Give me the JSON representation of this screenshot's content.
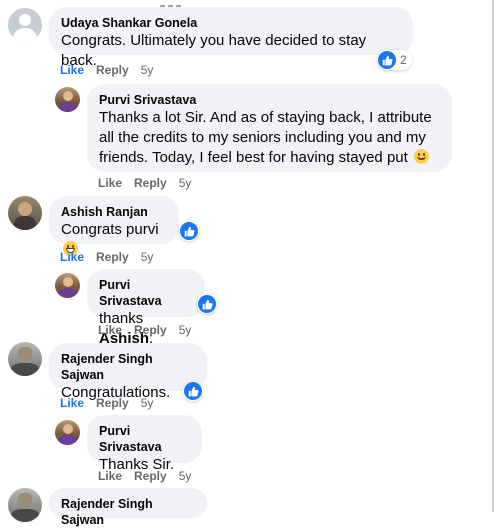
{
  "comments": [
    {
      "author": "Udaya Shankar Gonela",
      "text": "Congrats. Ultimately you have decided to stay back.",
      "reaction_count": "2",
      "like": "Like",
      "reply": "Reply",
      "age": "5y"
    },
    {
      "author": "Purvi Srivastava",
      "lines": [
        "Thanks a lot Sir. And as of staying back, I attribute",
        "all the credits to my seniors including you and my",
        "friends. Today, I feel best for having stayed put"
      ],
      "like": "Like",
      "reply": "Reply",
      "age": "5y"
    },
    {
      "author": "Ashish Ranjan",
      "text": "Congrats purvi",
      "like": "Like",
      "reply": "Reply",
      "age": "5y"
    },
    {
      "author": "Purvi Srivastava",
      "text_prefix": "thanks",
      "mention": "Ashish",
      "text_suffix": ".",
      "like": "Like",
      "reply": "Reply",
      "age": "5y"
    },
    {
      "author": "Rajender Singh Sajwan",
      "text": "Congratulations.",
      "like": "Like",
      "reply": "Reply",
      "age": "5y"
    },
    {
      "author": "Purvi Srivastava",
      "text": "Thanks Sir.",
      "like": "Like",
      "reply": "Reply",
      "age": "5y"
    },
    {
      "author": "Rajender Singh Sajwan"
    }
  ],
  "icons": {
    "like_reaction": "thumbs-up-icon",
    "smile": "smiling-face-emoji",
    "grin": "grinning-face-emoji"
  },
  "colors": {
    "like_blue": "#1877f2",
    "bubble_bg": "#f0f2f5",
    "meta_gray": "#65676b"
  }
}
